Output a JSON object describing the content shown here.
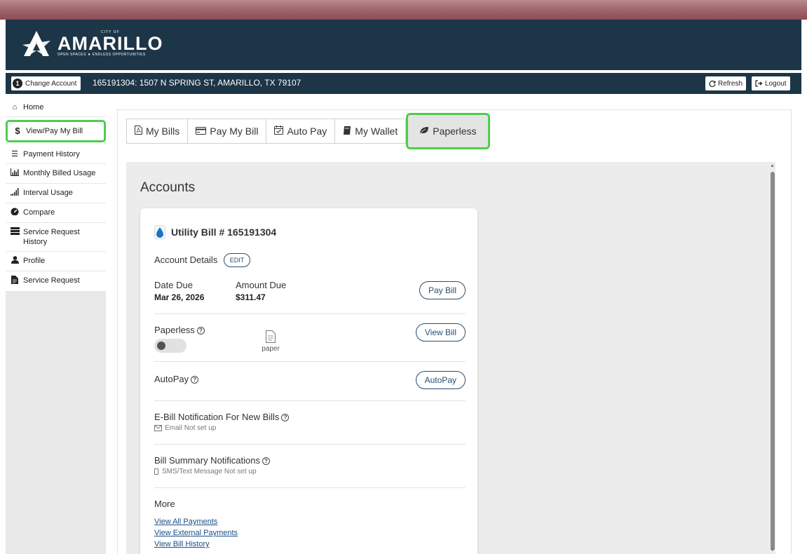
{
  "header": {
    "logo_city": "CITY OF",
    "logo_name": "AMARILLO",
    "logo_tagline": "OPEN SPACES ★ ENDLESS OPPORTUNITIES"
  },
  "account_bar": {
    "change_badge": "1",
    "change_label": "Change Account",
    "account": "165191304: 1507 N SPRING ST, AMARILLO, TX 79107",
    "refresh_label": "Refresh",
    "logout_label": "Logout"
  },
  "sidebar": {
    "items": [
      {
        "label": "Home",
        "icon": "home-icon"
      },
      {
        "label": "View/Pay My Bill",
        "icon": "dollar-icon",
        "active": true
      },
      {
        "label": "Payment History",
        "icon": "list-icon"
      },
      {
        "label": "Monthly Billed Usage",
        "icon": "bar-chart-icon"
      },
      {
        "label": "Interval Usage",
        "icon": "signal-bars-icon"
      },
      {
        "label": "Compare",
        "icon": "gauge-icon"
      },
      {
        "label": "Service Request History",
        "icon": "server-icon"
      },
      {
        "label": "Profile",
        "icon": "user-icon"
      },
      {
        "label": "Service Request",
        "icon": "document-icon"
      }
    ]
  },
  "tabs": [
    {
      "label": "My Bills",
      "icon": "pdf-icon"
    },
    {
      "label": "Pay My Bill",
      "icon": "credit-card-icon"
    },
    {
      "label": "Auto Pay",
      "icon": "calendar-check-icon"
    },
    {
      "label": "My Wallet",
      "icon": "wallet-icon"
    },
    {
      "label": "Paperless",
      "icon": "leaf-icon",
      "active": true
    }
  ],
  "accounts": {
    "title": "Accounts",
    "card": {
      "title": "Utility Bill # 165191304",
      "account_details_label": "Account Details",
      "edit_label": "EDIT",
      "date_due_label": "Date Due",
      "date_due_value": "Mar 26, 2026",
      "amount_due_label": "Amount Due",
      "amount_due_value": "$311.47",
      "pay_bill_label": "Pay Bill",
      "paperless_label": "Paperless",
      "paperless_enabled": false,
      "paper_label": "paper",
      "view_bill_label": "View Bill",
      "autopay_label": "AutoPay",
      "autopay_button": "AutoPay",
      "ebill_label": "E-Bill Notification For New Bills",
      "ebill_status": "Email Not set up",
      "summary_label": "Bill Summary Notifications",
      "summary_status": "SMS/Text Message Not set up",
      "more_label": "More",
      "links": [
        "View All Payments",
        "View External Payments",
        "View Bill History"
      ]
    }
  },
  "colors": {
    "header_bg": "#1c3547",
    "highlight": "#4cce4c",
    "button_outline": "#2b4f6e"
  }
}
